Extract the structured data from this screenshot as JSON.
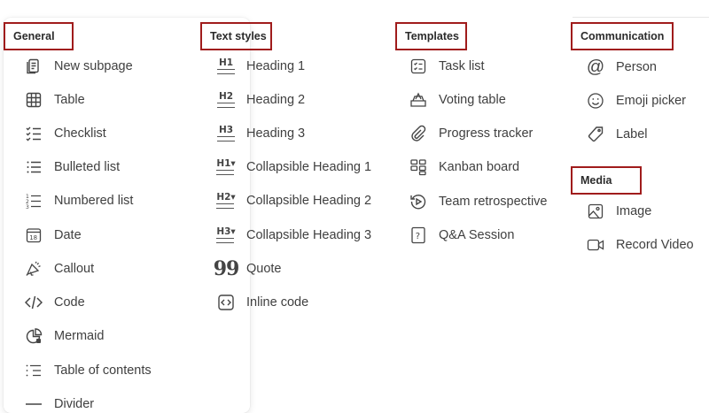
{
  "general": {
    "header": "General",
    "items": [
      {
        "label": "New subpage",
        "icon": "new-subpage-icon"
      },
      {
        "label": "Table",
        "icon": "table-icon"
      },
      {
        "label": "Checklist",
        "icon": "checklist-icon"
      },
      {
        "label": "Bulleted list",
        "icon": "bulleted-list-icon"
      },
      {
        "label": "Numbered list",
        "icon": "numbered-list-icon"
      },
      {
        "label": "Date",
        "icon": "calendar-icon",
        "icon_text": "18"
      },
      {
        "label": "Callout",
        "icon": "callout-megaphone-icon"
      },
      {
        "label": "Code",
        "icon": "code-icon"
      },
      {
        "label": "Mermaid",
        "icon": "mermaid-icon"
      },
      {
        "label": "Table of contents",
        "icon": "table-of-contents-icon"
      },
      {
        "label": "Divider",
        "icon": "divider-icon"
      }
    ]
  },
  "text_styles": {
    "header": "Text styles",
    "items": [
      {
        "label": "Heading 1",
        "icon": "heading-1-icon",
        "icon_text": "H1"
      },
      {
        "label": "Heading 2",
        "icon": "heading-2-icon",
        "icon_text": "H2"
      },
      {
        "label": "Heading 3",
        "icon": "heading-3-icon",
        "icon_text": "H3"
      },
      {
        "label": "Collapsible Heading 1",
        "icon": "collapsible-heading-1-icon",
        "icon_text": "H1▾"
      },
      {
        "label": "Collapsible Heading 2",
        "icon": "collapsible-heading-2-icon",
        "icon_text": "H2▾"
      },
      {
        "label": "Collapsible Heading 3",
        "icon": "collapsible-heading-3-icon",
        "icon_text": "H3▾"
      },
      {
        "label": "Quote",
        "icon": "quote-icon",
        "icon_text": "99"
      },
      {
        "label": "Inline code",
        "icon": "inline-code-icon"
      }
    ]
  },
  "templates": {
    "header": "Templates",
    "items": [
      {
        "label": "Task list",
        "icon": "task-list-icon"
      },
      {
        "label": "Voting table",
        "icon": "voting-table-icon"
      },
      {
        "label": "Progress tracker",
        "icon": "progress-tracker-icon"
      },
      {
        "label": "Kanban board",
        "icon": "kanban-board-icon"
      },
      {
        "label": "Team retrospective",
        "icon": "team-retrospective-icon"
      },
      {
        "label": "Q&A Session",
        "icon": "qa-session-icon",
        "icon_text": "?"
      }
    ]
  },
  "communication": {
    "header": "Communication",
    "items": [
      {
        "label": "Person",
        "icon": "at-sign-icon",
        "icon_text": "@"
      },
      {
        "label": "Emoji picker",
        "icon": "emoji-icon"
      },
      {
        "label": "Label",
        "icon": "label-tag-icon"
      }
    ]
  },
  "media": {
    "header": "Media",
    "items": [
      {
        "label": "Image",
        "icon": "image-icon"
      },
      {
        "label": "Record Video",
        "icon": "video-camera-icon"
      }
    ]
  },
  "colors": {
    "highlight_border": "#a01c1c",
    "text": "#3f3f3f",
    "icon": "#444444"
  }
}
